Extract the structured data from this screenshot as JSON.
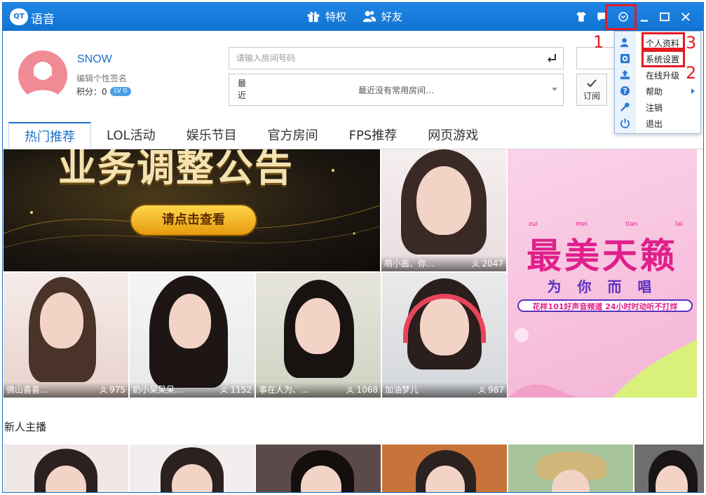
{
  "titlebar": {
    "logo_text": "QT",
    "app_name": "语音",
    "privilege_label": "特权",
    "friends_label": "好友"
  },
  "profile": {
    "username": "SNOW",
    "signature": "编辑个性签名",
    "score_label": "积分：0",
    "level": "LV 0"
  },
  "search": {
    "placeholder": "请输入房间号码",
    "recent_label": "最近",
    "recent_text": "最近没有常用房间…",
    "subscribe_label": "订阅"
  },
  "tabs": [
    {
      "label": "热门推荐",
      "active": true
    },
    {
      "label": "LOL活动"
    },
    {
      "label": "娱乐节目"
    },
    {
      "label": "官方房间"
    },
    {
      "label": "FPS推荐"
    },
    {
      "label": "网页游戏"
    }
  ],
  "banner": {
    "headline": "业务调整公告",
    "button_label": "请点击查看"
  },
  "promo": {
    "pinyin": [
      "zui",
      "mei",
      "tian",
      "lai"
    ],
    "headline": "最美天籁",
    "subline": "为 你 而 唱",
    "footer": "花样101好声音频道   24小时时动听不打烊"
  },
  "tiles": [
    {
      "name": "萌小酱、你...",
      "viewers": "2047"
    },
    {
      "name": "佛山喜喜...",
      "viewers": "975"
    },
    {
      "name": "奶小呆呆呆...",
      "viewers": "1152"
    },
    {
      "name": "事在人为、...",
      "viewers": "1068"
    },
    {
      "name": "加油梦儿",
      "viewers": "987"
    }
  ],
  "new_anchors_title": "新人主播",
  "menu": {
    "items": [
      {
        "label": "个人资料",
        "icon": "user-icon"
      },
      {
        "label": "系统设置",
        "icon": "gear-icon"
      },
      {
        "label": "在线升级",
        "icon": "upload-icon"
      },
      {
        "label": "帮助",
        "icon": "help-icon",
        "submenu": true
      },
      {
        "label": "注销",
        "icon": "key-icon"
      },
      {
        "label": "退出",
        "icon": "power-icon"
      }
    ]
  },
  "annotations": [
    "1",
    "2",
    "3"
  ],
  "colors": {
    "titlebar": "#1273d2",
    "accent": "#1a6fc9",
    "annotation": "#e51b23",
    "promo_magenta": "#e0208c"
  }
}
